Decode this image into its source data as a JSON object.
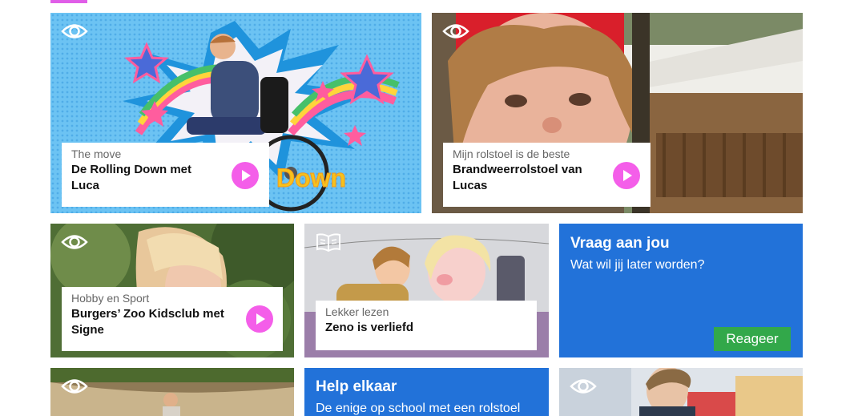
{
  "colors": {
    "accent": "#e05ee8",
    "play": "#f45ee9",
    "tile_blue": "#2272d9",
    "button_green": "#32a84a"
  },
  "icons": {
    "watch": "eye-icon",
    "read": "book-icon",
    "play": "play-icon"
  },
  "cards": [
    {
      "category": "The move",
      "title": "De Rolling Down met Luca",
      "icon": "eye-icon"
    },
    {
      "category": "Mijn rolstoel is de beste",
      "title": "Brandweerrolstoel van Lucas",
      "icon": "eye-icon"
    },
    {
      "category": "Hobby en Sport",
      "title": "Burgers’ Zoo Kidsclub met Signe",
      "icon": "eye-icon"
    },
    {
      "category": "Lekker lezen",
      "title": "Zeno is verliefd",
      "icon": "book-icon"
    }
  ],
  "thumb_text": {
    "down": "Down"
  },
  "question_card": {
    "title": "Vraag aan jou",
    "subtitle": "Wat wil jij later worden?",
    "button": "Reageer"
  },
  "help_card": {
    "title": "Help elkaar",
    "subtitle": "De enige op school met een rolstoel"
  }
}
